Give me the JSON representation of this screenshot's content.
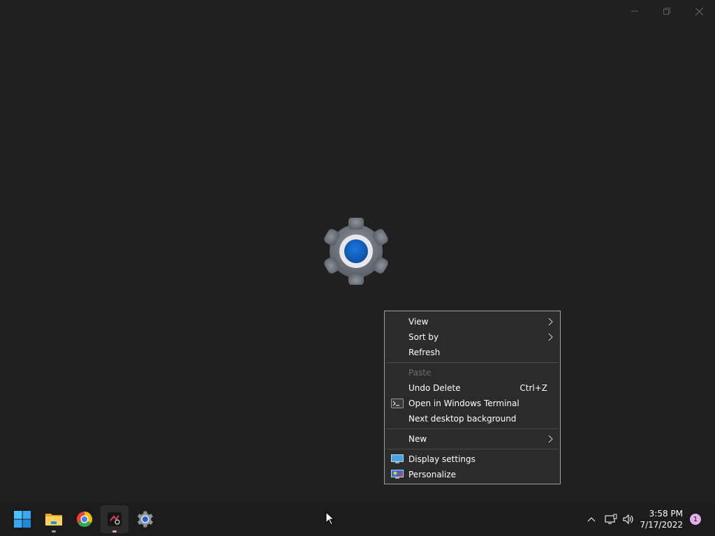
{
  "window_controls": {
    "minimize_icon": "minimize-icon",
    "restore_icon": "restore-icon",
    "close_icon": "close-icon"
  },
  "splash": {
    "icon": "settings-gear-icon",
    "accent": "#0f5fbf"
  },
  "context_menu": {
    "groups": [
      [
        {
          "label": "View",
          "submenu": true
        },
        {
          "label": "Sort by",
          "submenu": true
        },
        {
          "label": "Refresh"
        }
      ],
      [
        {
          "label": "Paste",
          "disabled": true
        },
        {
          "label": "Undo Delete",
          "shortcut": "Ctrl+Z"
        },
        {
          "label": "Open in Windows Terminal",
          "icon": "terminal-icon"
        },
        {
          "label": "Next desktop background"
        }
      ],
      [
        {
          "label": "New",
          "submenu": true
        }
      ],
      [
        {
          "label": "Display settings",
          "icon": "display-icon"
        },
        {
          "label": "Personalize",
          "icon": "personalize-icon"
        }
      ]
    ]
  },
  "taskbar": {
    "apps": [
      {
        "name": "start",
        "icon": "windows-start-icon"
      },
      {
        "name": "file-explorer",
        "icon": "folder-icon",
        "running": true
      },
      {
        "name": "chrome",
        "icon": "chrome-icon"
      },
      {
        "name": "app-active",
        "icon": "app-icon",
        "running": true,
        "active": true
      },
      {
        "name": "settings",
        "icon": "gear-icon"
      }
    ],
    "tray": {
      "chevron_icon": "chevron-up-icon",
      "network_icon": "network-icon",
      "volume_icon": "volume-icon"
    },
    "clock": {
      "time": "3:58 PM",
      "date": "7/17/2022"
    },
    "notification_count": "1"
  }
}
